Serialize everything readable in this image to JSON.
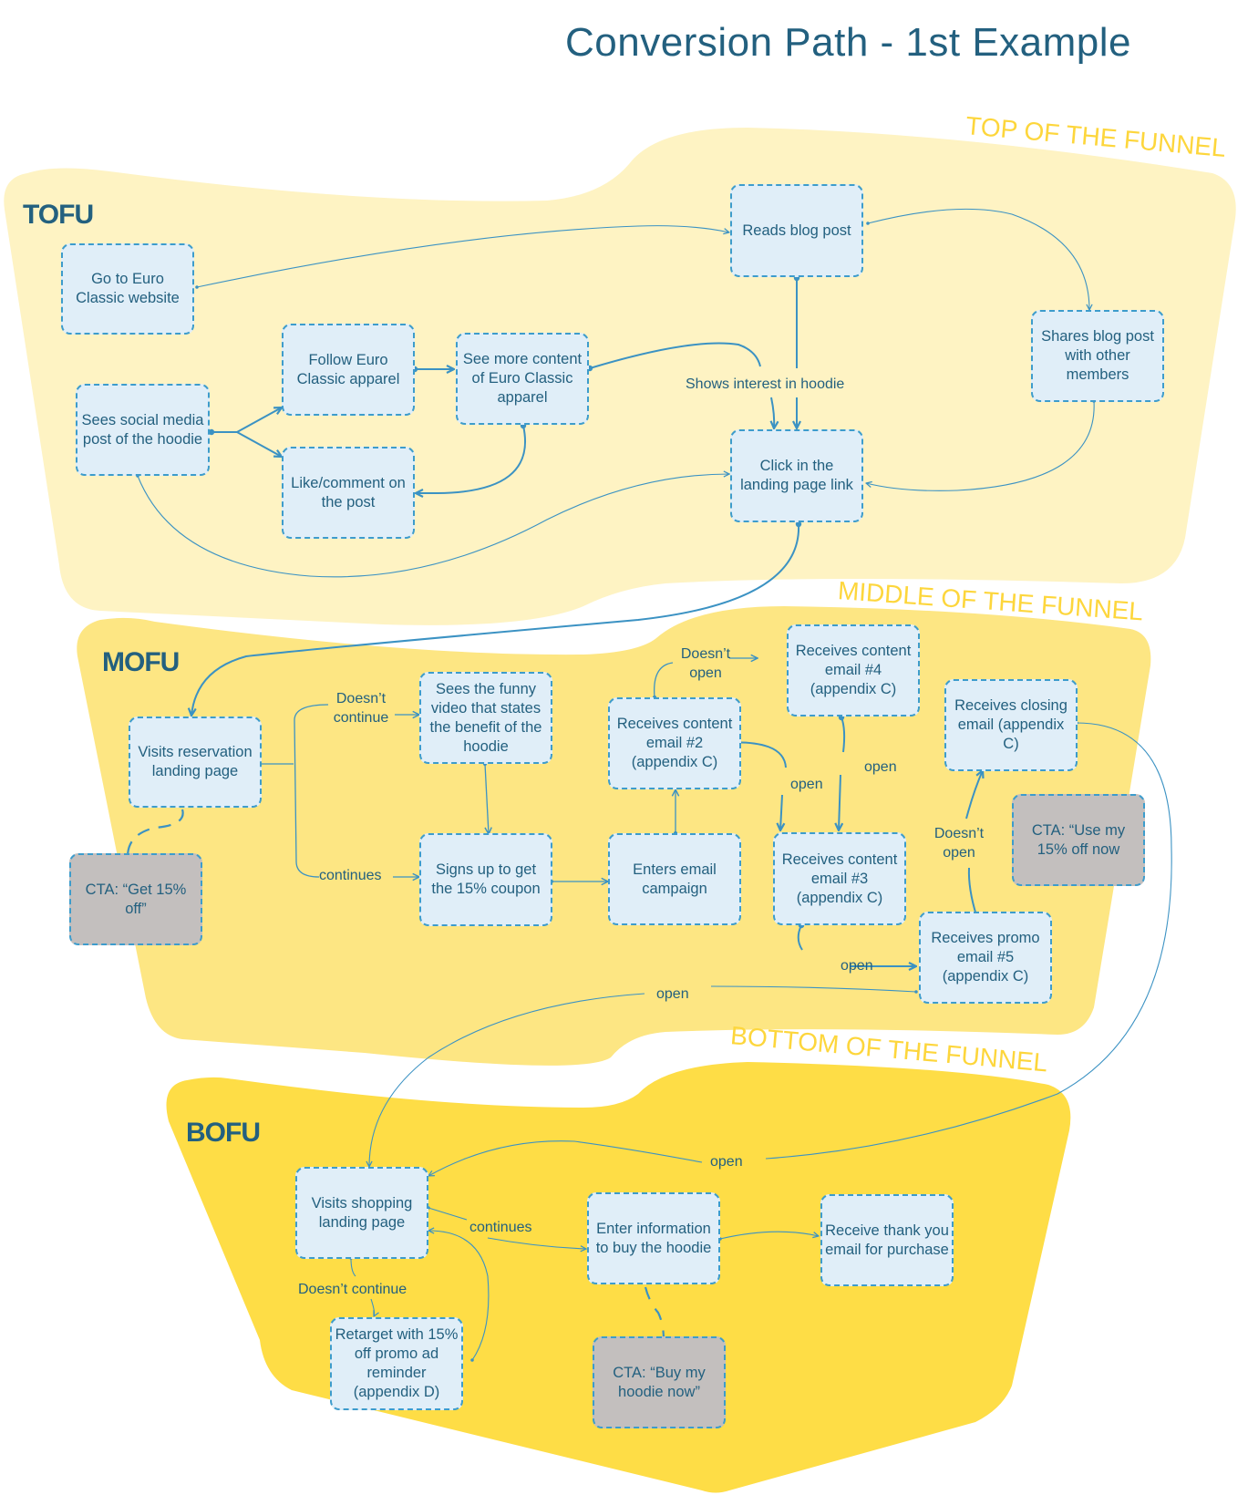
{
  "title": "Conversion Path - 1st Example",
  "colors": {
    "tofu_band": "#fef3c3",
    "mofu_band": "#fde683",
    "bofu_band": "#fedd46",
    "band_label": "#fdd63c",
    "node_fill": "#e0eef8",
    "node_border": "#3d9ccc",
    "cta_fill": "#c3bfbe",
    "text": "#23607f",
    "connector": "#3b92c3"
  },
  "stages": {
    "tofu": {
      "label": "TOFU",
      "band_label": "TOP OF THE FUNNEL"
    },
    "mofu": {
      "label": "MOFU",
      "band_label": "MIDDLE OF THE FUNNEL"
    },
    "bofu": {
      "label": "BOFU",
      "band_label": "BOTTOM OF THE FUNNEL"
    }
  },
  "nodes": {
    "go_to_website": "Go to Euro Classic website",
    "reads_blog": "Reads blog post",
    "shares_blog": "Shares blog post with other members",
    "sees_social": "Sees social media post of the hoodie",
    "follow": "Follow Euro Classic apparel",
    "see_more": "See more content of Euro Classic apparel",
    "like_comment": "Like/comment on the post",
    "click_landing": "Click in the landing page link",
    "visits_reservation": "Visits reservation landing page",
    "cta_get15": "CTA: “Get 15% off”",
    "funny_video": "Sees the funny video that states the benefit of the hoodie",
    "signs_up": "Signs up to get the 15% coupon",
    "enters_campaign": "Enters email campaign",
    "email2": "Receives content email #2 (appendix C)",
    "email4": "Receives content email #4 (appendix C)",
    "email3": "Receives content email #3 (appendix C)",
    "closing_email": "Receives closing email (appendix C)",
    "cta_use15": "CTA: “Use my 15% off now",
    "promo5": "Receives promo email #5 (appendix C)",
    "visits_shopping": "Visits shopping landing page",
    "retarget": "Retarget with 15% off promo ad reminder (appendix D)",
    "enter_info": "Enter information to buy the hoodie",
    "thank_you": "Receive thank you email for purchase",
    "cta_buy": "CTA: “Buy my hoodie now”"
  },
  "edge_labels": {
    "shows_interest": "Shows interest in hoodie",
    "mofu_doesnt_continue": "Doesn’t continue",
    "mofu_continues": "continues",
    "doesnt_open_1": "Doesn’t open",
    "open_2_3": "open",
    "open_4_3": "open",
    "open_3_5": "open",
    "doesnt_open_2": "Doesn’t open",
    "open_5_bofu": "open",
    "open_closing_bofu": "open",
    "bofu_continues": "continues",
    "bofu_doesnt_continue": "Doesn’t continue"
  }
}
